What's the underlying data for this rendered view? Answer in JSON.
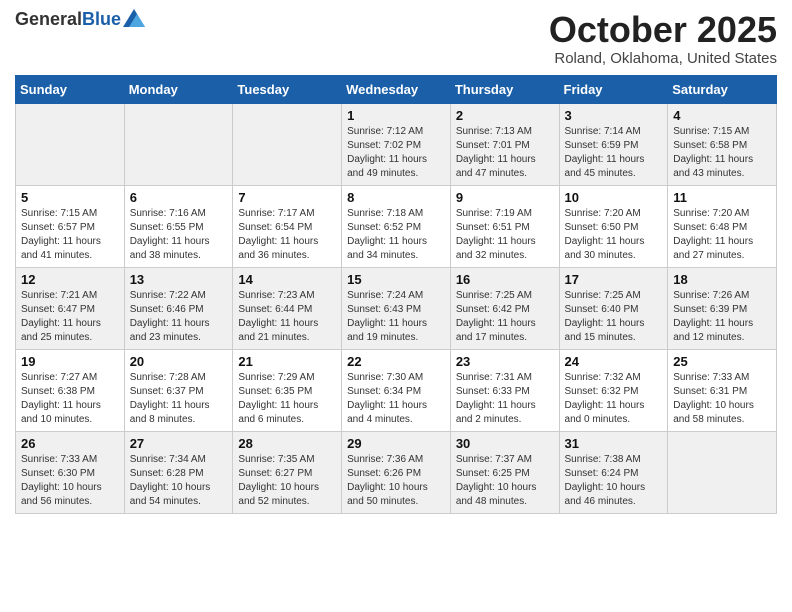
{
  "header": {
    "logo_general": "General",
    "logo_blue": "Blue",
    "month": "October 2025",
    "location": "Roland, Oklahoma, United States"
  },
  "weekdays": [
    "Sunday",
    "Monday",
    "Tuesday",
    "Wednesday",
    "Thursday",
    "Friday",
    "Saturday"
  ],
  "weeks": [
    [
      {
        "day": "",
        "info": ""
      },
      {
        "day": "",
        "info": ""
      },
      {
        "day": "",
        "info": ""
      },
      {
        "day": "1",
        "info": "Sunrise: 7:12 AM\nSunset: 7:02 PM\nDaylight: 11 hours\nand 49 minutes."
      },
      {
        "day": "2",
        "info": "Sunrise: 7:13 AM\nSunset: 7:01 PM\nDaylight: 11 hours\nand 47 minutes."
      },
      {
        "day": "3",
        "info": "Sunrise: 7:14 AM\nSunset: 6:59 PM\nDaylight: 11 hours\nand 45 minutes."
      },
      {
        "day": "4",
        "info": "Sunrise: 7:15 AM\nSunset: 6:58 PM\nDaylight: 11 hours\nand 43 minutes."
      }
    ],
    [
      {
        "day": "5",
        "info": "Sunrise: 7:15 AM\nSunset: 6:57 PM\nDaylight: 11 hours\nand 41 minutes."
      },
      {
        "day": "6",
        "info": "Sunrise: 7:16 AM\nSunset: 6:55 PM\nDaylight: 11 hours\nand 38 minutes."
      },
      {
        "day": "7",
        "info": "Sunrise: 7:17 AM\nSunset: 6:54 PM\nDaylight: 11 hours\nand 36 minutes."
      },
      {
        "day": "8",
        "info": "Sunrise: 7:18 AM\nSunset: 6:52 PM\nDaylight: 11 hours\nand 34 minutes."
      },
      {
        "day": "9",
        "info": "Sunrise: 7:19 AM\nSunset: 6:51 PM\nDaylight: 11 hours\nand 32 minutes."
      },
      {
        "day": "10",
        "info": "Sunrise: 7:20 AM\nSunset: 6:50 PM\nDaylight: 11 hours\nand 30 minutes."
      },
      {
        "day": "11",
        "info": "Sunrise: 7:20 AM\nSunset: 6:48 PM\nDaylight: 11 hours\nand 27 minutes."
      }
    ],
    [
      {
        "day": "12",
        "info": "Sunrise: 7:21 AM\nSunset: 6:47 PM\nDaylight: 11 hours\nand 25 minutes."
      },
      {
        "day": "13",
        "info": "Sunrise: 7:22 AM\nSunset: 6:46 PM\nDaylight: 11 hours\nand 23 minutes."
      },
      {
        "day": "14",
        "info": "Sunrise: 7:23 AM\nSunset: 6:44 PM\nDaylight: 11 hours\nand 21 minutes."
      },
      {
        "day": "15",
        "info": "Sunrise: 7:24 AM\nSunset: 6:43 PM\nDaylight: 11 hours\nand 19 minutes."
      },
      {
        "day": "16",
        "info": "Sunrise: 7:25 AM\nSunset: 6:42 PM\nDaylight: 11 hours\nand 17 minutes."
      },
      {
        "day": "17",
        "info": "Sunrise: 7:25 AM\nSunset: 6:40 PM\nDaylight: 11 hours\nand 15 minutes."
      },
      {
        "day": "18",
        "info": "Sunrise: 7:26 AM\nSunset: 6:39 PM\nDaylight: 11 hours\nand 12 minutes."
      }
    ],
    [
      {
        "day": "19",
        "info": "Sunrise: 7:27 AM\nSunset: 6:38 PM\nDaylight: 11 hours\nand 10 minutes."
      },
      {
        "day": "20",
        "info": "Sunrise: 7:28 AM\nSunset: 6:37 PM\nDaylight: 11 hours\nand 8 minutes."
      },
      {
        "day": "21",
        "info": "Sunrise: 7:29 AM\nSunset: 6:35 PM\nDaylight: 11 hours\nand 6 minutes."
      },
      {
        "day": "22",
        "info": "Sunrise: 7:30 AM\nSunset: 6:34 PM\nDaylight: 11 hours\nand 4 minutes."
      },
      {
        "day": "23",
        "info": "Sunrise: 7:31 AM\nSunset: 6:33 PM\nDaylight: 11 hours\nand 2 minutes."
      },
      {
        "day": "24",
        "info": "Sunrise: 7:32 AM\nSunset: 6:32 PM\nDaylight: 11 hours\nand 0 minutes."
      },
      {
        "day": "25",
        "info": "Sunrise: 7:33 AM\nSunset: 6:31 PM\nDaylight: 10 hours\nand 58 minutes."
      }
    ],
    [
      {
        "day": "26",
        "info": "Sunrise: 7:33 AM\nSunset: 6:30 PM\nDaylight: 10 hours\nand 56 minutes."
      },
      {
        "day": "27",
        "info": "Sunrise: 7:34 AM\nSunset: 6:28 PM\nDaylight: 10 hours\nand 54 minutes."
      },
      {
        "day": "28",
        "info": "Sunrise: 7:35 AM\nSunset: 6:27 PM\nDaylight: 10 hours\nand 52 minutes."
      },
      {
        "day": "29",
        "info": "Sunrise: 7:36 AM\nSunset: 6:26 PM\nDaylight: 10 hours\nand 50 minutes."
      },
      {
        "day": "30",
        "info": "Sunrise: 7:37 AM\nSunset: 6:25 PM\nDaylight: 10 hours\nand 48 minutes."
      },
      {
        "day": "31",
        "info": "Sunrise: 7:38 AM\nSunset: 6:24 PM\nDaylight: 10 hours\nand 46 minutes."
      },
      {
        "day": "",
        "info": ""
      }
    ]
  ]
}
